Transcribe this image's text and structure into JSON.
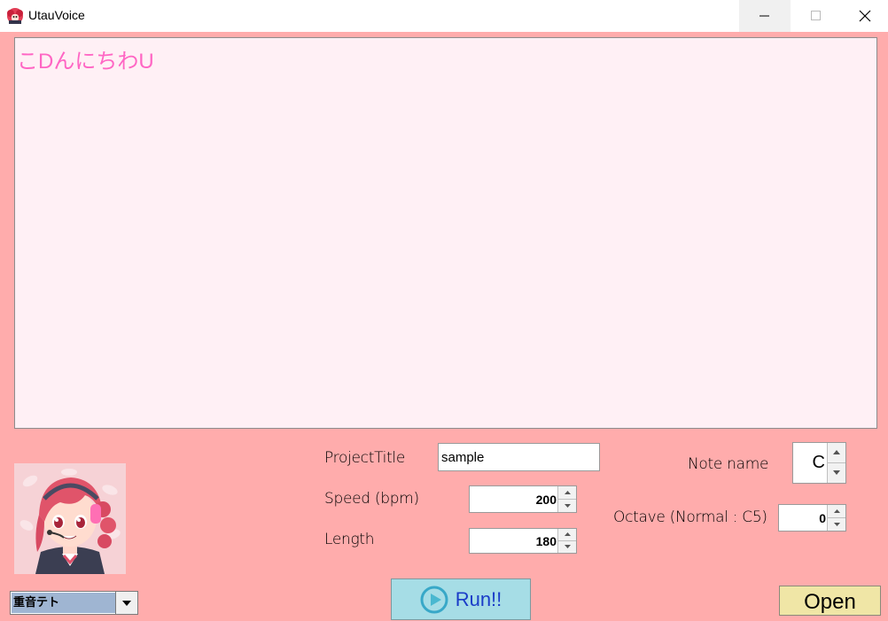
{
  "window": {
    "title": "UtauVoice"
  },
  "lyrics": {
    "value": "こDんにちわU"
  },
  "voice": {
    "selected": "重音テト"
  },
  "form": {
    "project_title_label": "ProjectTitle",
    "project_title_value": "sample",
    "speed_label": "Speed (bpm)",
    "speed_value": "200",
    "length_label": "Length",
    "length_value": "180",
    "note_name_label": "Note name",
    "note_name_value": "C",
    "octave_label": "Octave (Normal : C5)",
    "octave_value": "0"
  },
  "buttons": {
    "run_label": "Run!!",
    "open_label": "Open"
  },
  "colors": {
    "background": "#ffacac",
    "textarea_bg": "#fff0f5",
    "lyrics_text": "#ff66c4",
    "run_button": "#a6dde6",
    "open_button": "#f0e6a6"
  }
}
